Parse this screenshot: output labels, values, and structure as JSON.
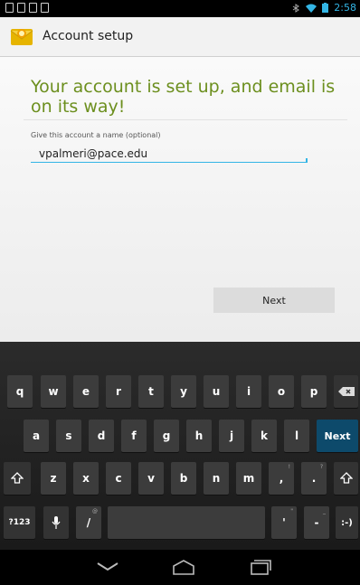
{
  "status_bar": {
    "time": "2:58"
  },
  "action_bar": {
    "title": "Account setup"
  },
  "content": {
    "headline": "Your account is set up, and email is on its way!",
    "name_label": "Give this account a name (optional)",
    "name_value": "vpalmeri@pace.edu",
    "next_label": "Next"
  },
  "keyboard": {
    "row1": [
      "q",
      "w",
      "e",
      "r",
      "t",
      "y",
      "u",
      "i",
      "o",
      "p"
    ],
    "row2": [
      "a",
      "s",
      "d",
      "f",
      "g",
      "h",
      "j",
      "k",
      "l"
    ],
    "row3": [
      "z",
      "x",
      "c",
      "v",
      "b",
      "n",
      "m"
    ],
    "action_label": "Next",
    "symbols_label": "?123",
    "comma_label": ",",
    "period_label": ".",
    "smiley_label": ":-)",
    "slash_label": "/",
    "apostrophe_label": "'",
    "dash_label": "-",
    "comma_hint": "!",
    "period_hint": "?",
    "slash_hint": "@",
    "apostrophe_hint": "\"",
    "dash_hint": "_"
  },
  "colors": {
    "accent": "#33b5e5",
    "headline": "#6c8f1e",
    "action_key": "#0d4a6b"
  }
}
